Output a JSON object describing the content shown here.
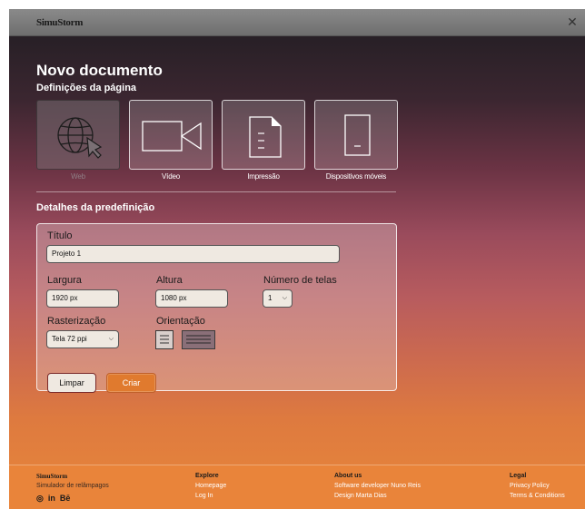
{
  "app": {
    "brand": "SimuStorm"
  },
  "header": {
    "title": "Novo documento",
    "subtitle": "Definições da página"
  },
  "presets": [
    {
      "label": "Web",
      "icon": "globe-cursor-icon",
      "selected": true
    },
    {
      "label": "Vídeo",
      "icon": "video-camera-icon",
      "selected": false
    },
    {
      "label": "Impressão",
      "icon": "document-icon",
      "selected": false
    },
    {
      "label": "Dispositivos móveis",
      "icon": "mobile-device-icon",
      "selected": false
    }
  ],
  "details": {
    "section_title": "Detalhes da predefinição",
    "title_label": "Título",
    "title_value": "Projeto 1",
    "width_label": "Largura",
    "width_value": "1920 px",
    "height_label": "Altura",
    "height_value": "1080 px",
    "screens_label": "Número de telas",
    "screens_value": "1",
    "raster_label": "Rasterização",
    "raster_value": "Tela 72 ppi",
    "orientation_label": "Orientação",
    "orientation_options": [
      "portrait",
      "landscape"
    ],
    "orientation_selected": "landscape",
    "clear_label": "Limpar",
    "create_label": "Criar"
  },
  "footer": {
    "col1": {
      "brand": "SimuStorm",
      "tagline": "Simulador de relâmpagos"
    },
    "col2": {
      "head": "Explore",
      "items": [
        "Homepage",
        "Log In"
      ]
    },
    "col3": {
      "head": "About us",
      "items": [
        "Software developer Nuno Reis",
        "Design Marta Dias"
      ]
    },
    "col4": {
      "head": "Legal",
      "items": [
        "Privacy Policy",
        "Terms & Conditions"
      ]
    },
    "socials": [
      "instagram-icon",
      "linkedin-icon",
      "behance-icon"
    ]
  },
  "colors": {
    "accent": "#e07a2e",
    "footer": "#e9843a"
  }
}
